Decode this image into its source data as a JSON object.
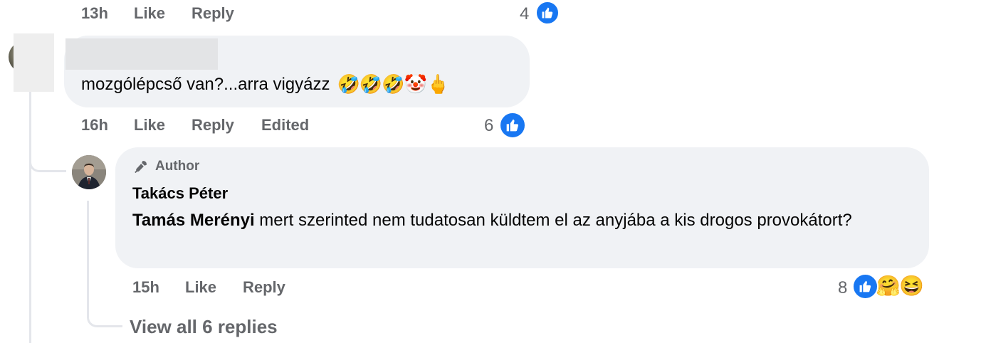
{
  "comment_prev": {
    "time": "13h",
    "like_label": "Like",
    "reply_label": "Reply",
    "reaction_count": "4"
  },
  "comment1": {
    "text": "mozgólépcső van?...arra vigyázz",
    "emojis": [
      "🤣",
      "🤣",
      "🤣",
      "🤡",
      "🖕"
    ],
    "time": "16h",
    "like_label": "Like",
    "reply_label": "Reply",
    "edited_label": "Edited",
    "reaction_count": "6"
  },
  "reply1": {
    "badge": "Author",
    "author": "Takács Péter",
    "mention": "Tamás Merényi",
    "text": " mert szerinted nem tudatosan küldtem el az anyjába a kis drogos provokátort?",
    "time": "15h",
    "like_label": "Like",
    "reply_label": "Reply",
    "reaction_count": "8",
    "reactions": [
      "like-icon",
      "care-icon",
      "haha-icon"
    ],
    "reaction_emojis": [
      "🤗",
      "😆"
    ]
  },
  "view_replies": "View all 6 replies",
  "colors": {
    "accent": "#1877f2",
    "bubble": "#f0f2f5",
    "meta": "#65676b"
  }
}
